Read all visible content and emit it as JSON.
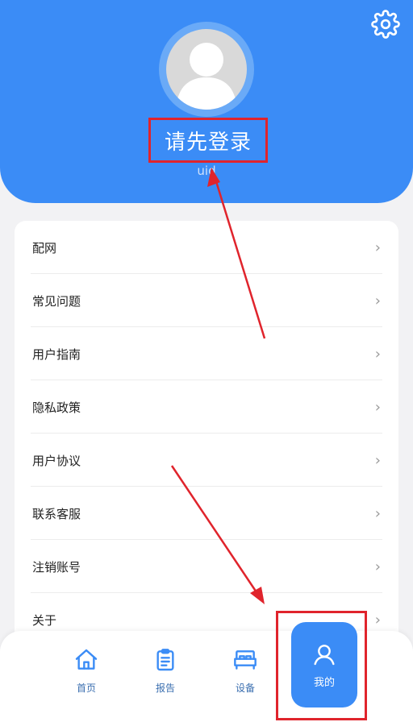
{
  "header": {
    "login_prompt": "请先登录",
    "uid_label": "uid"
  },
  "menu": {
    "items": [
      {
        "label": "配网"
      },
      {
        "label": "常见问题"
      },
      {
        "label": "用户指南"
      },
      {
        "label": "隐私政策"
      },
      {
        "label": "用户协议"
      },
      {
        "label": "联系客服"
      },
      {
        "label": "注销账号"
      },
      {
        "label": "关于"
      }
    ],
    "chevron": "›"
  },
  "tabbar": {
    "tabs": [
      {
        "label": "首页",
        "icon": "home-icon"
      },
      {
        "label": "报告",
        "icon": "clipboard-icon"
      },
      {
        "label": "设备",
        "icon": "bed-icon"
      },
      {
        "label": "我的",
        "icon": "user-icon",
        "active": true
      }
    ]
  },
  "colors": {
    "primary": "#3b8cf6",
    "annotation_red": "#e0242c"
  }
}
